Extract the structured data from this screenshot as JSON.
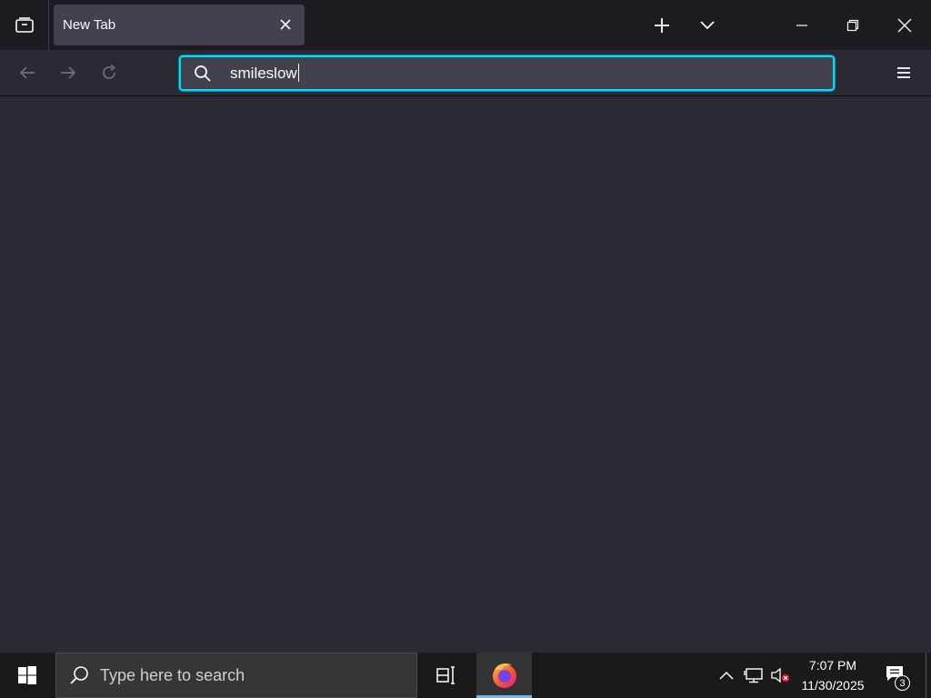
{
  "browser": {
    "tab": {
      "title": "New Tab"
    },
    "urlbar": {
      "value": "smileslow"
    }
  },
  "taskbar": {
    "search_placeholder": "Type here to search",
    "clock": {
      "time": "7:07 PM",
      "date": "11/30/2025"
    },
    "notification_count": "3"
  },
  "colors": {
    "tabstrip_bg": "#1c1b22",
    "toolbar_bg": "#2b2a33",
    "urlbar_bg": "#42414d",
    "urlbar_focus": "#00ddff",
    "taskbar_bg": "#1a1a1a",
    "taskbar_accent": "#76b9ed"
  },
  "icons": {
    "tab_list": "list-all-tabs-icon",
    "tab_close": "close-icon",
    "new_tab": "plus-icon",
    "tab_overflow": "chevron-down-icon",
    "back": "arrow-left-icon",
    "forward": "arrow-right-icon",
    "reload": "reload-icon",
    "url_search": "search-icon",
    "app_menu": "hamburger-menu-icon",
    "windows_start": "windows-logo-icon",
    "task_view": "task-view-icon",
    "firefox": "firefox-logo-icon",
    "tray_overflow": "chevron-up-icon",
    "network": "network-icon",
    "volume": "volume-muted-icon",
    "notifications": "action-center-icon"
  }
}
